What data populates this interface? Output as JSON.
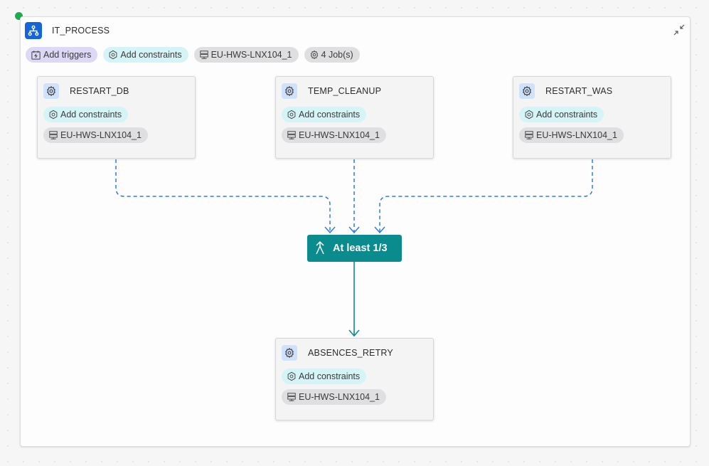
{
  "process": {
    "title": "IT_PROCESS",
    "toolbar": {
      "triggers_label": "Add triggers",
      "constraints_label": "Add constraints",
      "host_label": "EU-HWS-LNX104_1",
      "jobs_label": "4 Job(s)"
    }
  },
  "jobs": [
    {
      "title": "RESTART_DB",
      "constraints_label": "Add constraints",
      "host_label": "EU-HWS-LNX104_1"
    },
    {
      "title": "TEMP_CLEANUP",
      "constraints_label": "Add constraints",
      "host_label": "EU-HWS-LNX104_1"
    },
    {
      "title": "RESTART_WAS",
      "constraints_label": "Add constraints",
      "host_label": "EU-HWS-LNX104_1"
    },
    {
      "title": "ABSENCES_RETRY",
      "constraints_label": "Add constraints",
      "host_label": "EU-HWS-LNX104_1"
    }
  ],
  "gate": {
    "label": "At least 1/3"
  },
  "colors": {
    "accent_blue": "#1565d8",
    "gate_teal": "#0a8c8f",
    "status_green": "#1eaa4e",
    "dashed_link": "#2f7de1"
  },
  "icons": {
    "process": "process-flow-icon",
    "collapse": "collapse-icon",
    "trigger": "trigger-icon",
    "constraint": "constraint-icon",
    "host": "server-icon",
    "job": "gear-icon",
    "gate": "merge-icon"
  }
}
